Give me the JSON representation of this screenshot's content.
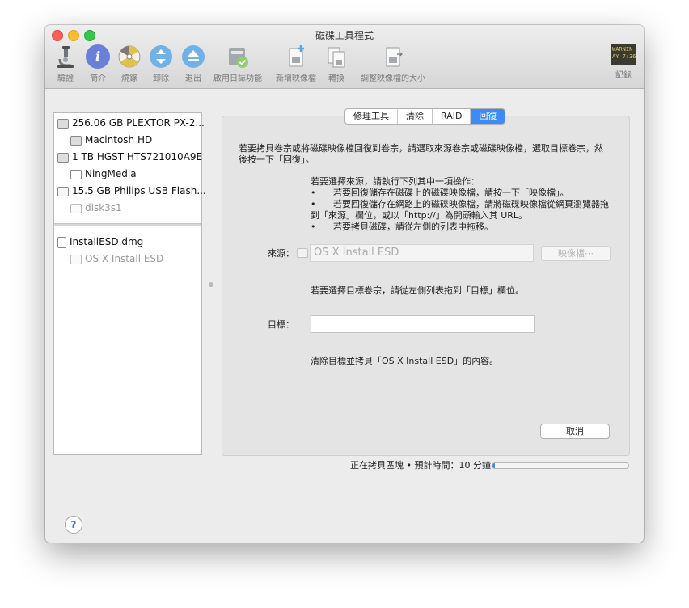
{
  "window": {
    "title": "磁碟工具程式"
  },
  "toolbar": {
    "verify": "驗證",
    "info": "簡介",
    "burn": "燒錄",
    "unmount": "卸除",
    "eject": "退出",
    "enable_journaling": "啟用日誌功能",
    "new_image": "新增映像檔",
    "convert": "轉換",
    "resize_image": "調整映像檔的大小",
    "log": "記錄",
    "log_icon_text": "WARNIN\nAY 7:36"
  },
  "sidebar": {
    "items": [
      {
        "label": "256.06 GB PLEXTOR PX-2..."
      },
      {
        "label": "Macintosh HD"
      },
      {
        "label": "1 TB HGST HTS721010A9E"
      },
      {
        "label": "NingMedia"
      },
      {
        "label": "15.5 GB Philips USB Flash..."
      },
      {
        "label": "disk3s1"
      },
      {
        "label": "InstallESD.dmg"
      },
      {
        "label": "OS X Install ESD"
      }
    ]
  },
  "tabs": [
    {
      "label": "修理工具"
    },
    {
      "label": "清除"
    },
    {
      "label": "RAID"
    },
    {
      "label": "回復"
    }
  ],
  "restore": {
    "intro_line1": "若要拷貝卷宗或將磁碟映像檔回復到卷宗，請選取來源卷宗或磁碟映像檔，選取目標卷宗，然",
    "intro_line2": "後按一下「回復」。",
    "source_instr": "若要選擇來源，請執行下列其中一項操作：",
    "bullet1": "若要回復儲存在磁碟上的磁碟映像檔，請按一下「映像檔」。",
    "bullet2a": "若要回復儲存在網路上的磁碟映像檔，請將磁碟映像檔從網頁瀏覽器拖",
    "bullet2b": "到「來源」欄位，或以「http://」為開頭輸入其 URL。",
    "bullet3": "若要拷貝磁碟，請從左側的列表中拖移。",
    "bullet_char": "•",
    "source_label": "來源：",
    "source_value": "OS X Install ESD",
    "image_button": "映像檔⋯",
    "dest_instr": "若要選擇目標卷宗，請從左側列表拖到「目標」欄位。",
    "dest_label": "目標：",
    "dest_value": "",
    "erase_note": "清除目標並拷貝「OS X Install ESD」的內容。",
    "cancel_button": "取消"
  },
  "status": {
    "text": "正在拷貝區塊 • 預計時間：10 分鐘",
    "progress": 0.02
  },
  "help": {
    "label": "?"
  },
  "colors": {
    "accent": "#3b8cf5",
    "close": "#fc5f57",
    "minimize": "#fdbc2e",
    "maximize": "#33c748"
  }
}
